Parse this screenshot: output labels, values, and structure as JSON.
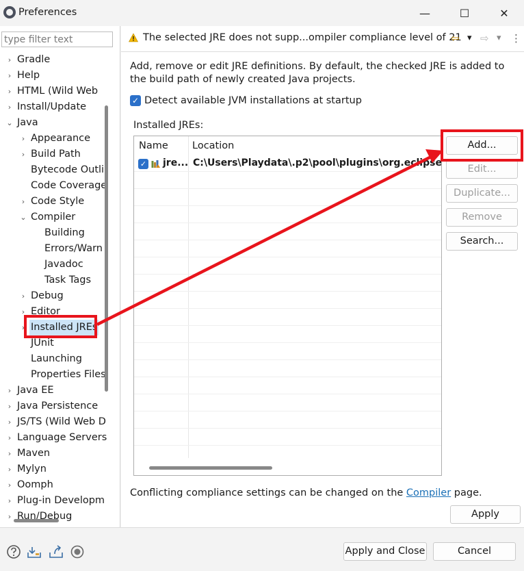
{
  "window": {
    "title": "Preferences",
    "minimize": "—",
    "maximize": "☐",
    "close": "✕"
  },
  "filter": {
    "placeholder": "type filter text"
  },
  "tree": [
    {
      "label": "Gradle",
      "chev": "›"
    },
    {
      "label": "Help",
      "chev": "›"
    },
    {
      "label": "HTML (Wild Web",
      "chev": "›"
    },
    {
      "label": "Install/Update",
      "chev": "›"
    },
    {
      "label": "Java",
      "chev": "⌄"
    },
    {
      "label": "Appearance",
      "chev": "›"
    },
    {
      "label": "Build Path",
      "chev": "›"
    },
    {
      "label": "Bytecode Outli",
      "chev": ""
    },
    {
      "label": "Code Coverage",
      "chev": ""
    },
    {
      "label": "Code Style",
      "chev": "›"
    },
    {
      "label": "Compiler",
      "chev": "⌄"
    },
    {
      "label": "Building",
      "chev": ""
    },
    {
      "label": "Errors/Warn",
      "chev": ""
    },
    {
      "label": "Javadoc",
      "chev": ""
    },
    {
      "label": "Task Tags",
      "chev": ""
    },
    {
      "label": "Debug",
      "chev": "›"
    },
    {
      "label": "Editor",
      "chev": "›"
    },
    {
      "label": "Installed JREs",
      "chev": "›"
    },
    {
      "label": "JUnit",
      "chev": ""
    },
    {
      "label": "Launching",
      "chev": ""
    },
    {
      "label": "Properties Files",
      "chev": ""
    },
    {
      "label": "Java EE",
      "chev": "›"
    },
    {
      "label": "Java Persistence",
      "chev": "›"
    },
    {
      "label": "JS/TS (Wild Web D",
      "chev": "›"
    },
    {
      "label": "Language Servers",
      "chev": "›"
    },
    {
      "label": "Maven",
      "chev": "›"
    },
    {
      "label": "Mylyn",
      "chev": "›"
    },
    {
      "label": "Oomph",
      "chev": "›"
    },
    {
      "label": "Plug-in Developm",
      "chev": "›"
    },
    {
      "label": "Run/Debug",
      "chev": "›"
    }
  ],
  "header": {
    "warning": "The selected JRE does not supp...ompiler compliance level of 21",
    "back": "⇦",
    "forward": "⇨",
    "dropdown": "▾",
    "menu": "⋮"
  },
  "description": "Add, remove or edit JRE definitions. By default, the checked JRE is added to the build path of newly created Java projects.",
  "detect": {
    "label": "Detect available JVM installations at startup",
    "checked": true
  },
  "installed_label": "Installed JREs:",
  "table": {
    "columns": [
      "Name",
      "Location"
    ],
    "rows": [
      {
        "name": "jre...",
        "location": "C:\\Users\\Playdata\\.p2\\pool\\plugins\\org.eclipse.",
        "checked": true
      }
    ]
  },
  "buttons": {
    "add": "Add...",
    "edit": "Edit...",
    "duplicate": "Duplicate...",
    "remove": "Remove",
    "search": "Search...",
    "apply": "Apply",
    "apply_close": "Apply and Close",
    "cancel": "Cancel"
  },
  "conflict": {
    "prefix": "Conflicting compliance settings can be changed on the ",
    "link": "Compiler",
    "suffix": " page."
  },
  "bottom_icons": [
    "help-icon",
    "import-icon",
    "export-icon",
    "record-icon"
  ],
  "colors": {
    "accent": "#2b70c9",
    "annotation": "#e8141c",
    "selection": "#cce4f7",
    "link": "#1a6fb6"
  }
}
